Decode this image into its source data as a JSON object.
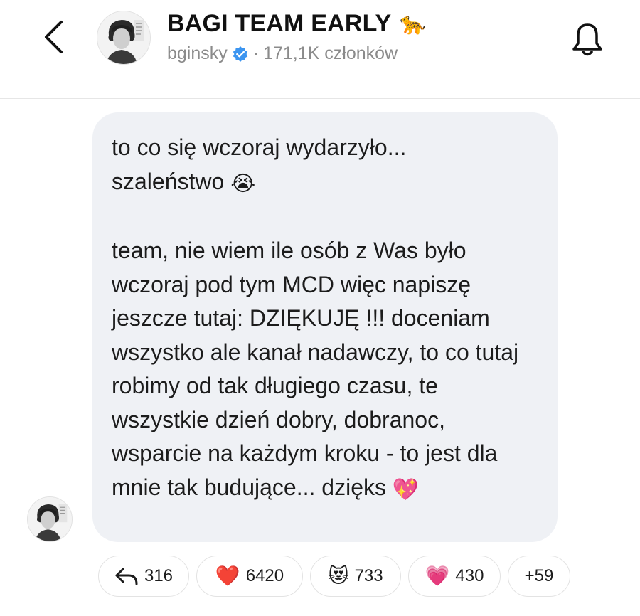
{
  "header": {
    "title": "BAGI TEAM EARLY",
    "title_emoji": "🐆",
    "username": "bginsky",
    "separator": "·",
    "member_count": "171,1K członków",
    "back_icon": "chevron-left-icon",
    "bell_icon": "bell-icon",
    "verified_icon": "verified-badge-icon",
    "verified_color": "#3c95f0"
  },
  "message": {
    "paragraph1_line1": "to co się wczoraj wydarzyło...",
    "paragraph1_line2": "szaleństwo",
    "paragraph1_emoji": "😭",
    "paragraph2_text": "team, nie wiem ile osób z Was było wczoraj pod tym MCD więc napiszę jeszcze tutaj: DZIĘKUJĘ !!! doceniam wszystko ale kanał nadawczy, to co tutaj robimy od tak długiego czasu, te wszystkie dzień dobry, dobranoc, wsparcie na każdym kroku - to jest dla mnie tak budujące... dzięks",
    "paragraph2_emoji": "💖"
  },
  "reactions": [
    {
      "icon": "reply-arrow-icon",
      "count": "316"
    },
    {
      "emoji": "❤️",
      "count": "6420"
    },
    {
      "emoji": "😻",
      "count": "733"
    },
    {
      "emoji": "💗",
      "count": "430"
    },
    {
      "count": "+59"
    }
  ],
  "colors": {
    "bubble_bg": "#eff1f5",
    "divider": "#e6e6e6",
    "subtitle": "#8b8b8b"
  }
}
